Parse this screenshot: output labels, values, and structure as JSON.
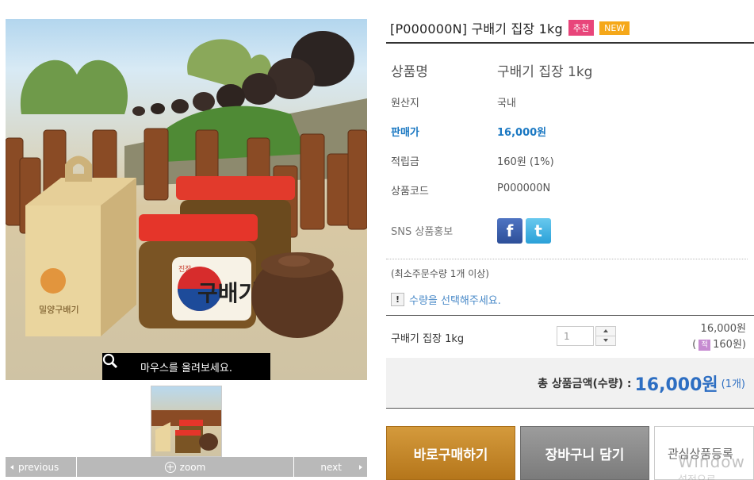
{
  "product_image": {
    "zoom_hint": "마우스를 올려보세요.",
    "box_label": "밀양구배기",
    "jar_label_brand": "구배기",
    "jar_label_small": "진장"
  },
  "image_nav": {
    "previous_label": "previous",
    "zoom_label": "zoom",
    "next_label": "next"
  },
  "product": {
    "title": "[P000000N] 구배기 집장 1kg",
    "badges": [
      "추천",
      "NEW"
    ],
    "fields": [
      {
        "label": "상품명",
        "value": "구배기 집장 1kg"
      },
      {
        "label": "원산지",
        "value": "국내"
      },
      {
        "label": "판매가",
        "value": "16,000원"
      },
      {
        "label": "적립금",
        "value": "160원 (1%)"
      },
      {
        "label": "상품코드",
        "value": "P000000N"
      },
      {
        "label": "SNS 상품홍보",
        "value": ""
      }
    ],
    "sns": [
      "facebook-icon",
      "twitter-icon"
    ],
    "min_order": "(최소주문수량 1개 이상)",
    "notice_icon": "!",
    "notice": "수량을 선택해주세요."
  },
  "option": {
    "name": "구배기 집장 1kg",
    "quantity": "1",
    "price": "16,000원",
    "point_badge": "적",
    "point": "160원)",
    "point_open": "("
  },
  "total": {
    "label": "총 상품금액(수량) :",
    "amount": "16,000원",
    "count": "(1개)"
  },
  "buttons": {
    "buy": "바로구매하기",
    "cart": "장바구니 담기",
    "wishlist": "관심상품등록"
  },
  "overlay": {
    "watermark": "Window",
    "watermark_sub": "설정으로"
  },
  "colors": {
    "price": "#1a78c2",
    "badge_recommend": "#e8457a",
    "badge_new": "#f5a81a",
    "buy_button": "#c4882a",
    "cart_button": "#8a8a8a",
    "total_amount": "#2d6ec2"
  }
}
